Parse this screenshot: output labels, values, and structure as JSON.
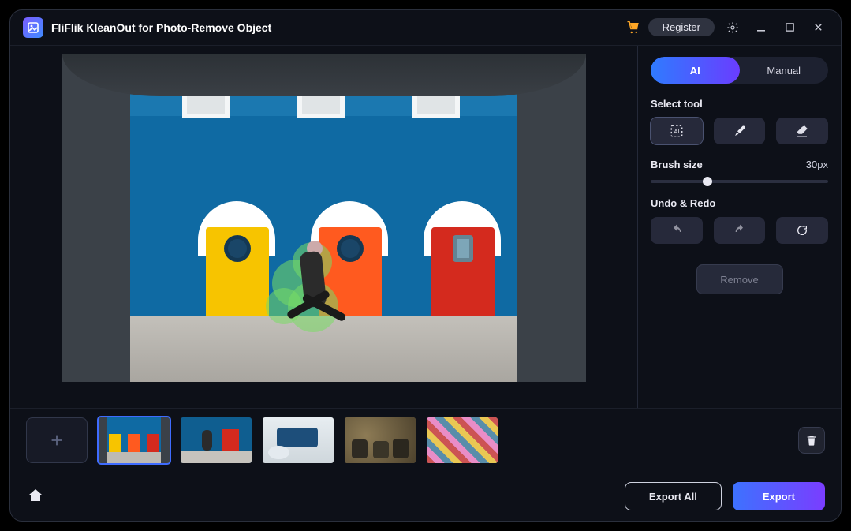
{
  "app": {
    "title": "FliFlik KleanOut for Photo-Remove Object"
  },
  "titlebar": {
    "register": "Register"
  },
  "sidebar": {
    "mode_ai": "AI",
    "mode_manual": "Manual",
    "select_tool_label": "Select tool",
    "brush_label": "Brush size",
    "brush_value": "30px",
    "undo_label": "Undo & Redo",
    "remove": "Remove"
  },
  "footer": {
    "export_all": "Export All",
    "export": "Export"
  }
}
